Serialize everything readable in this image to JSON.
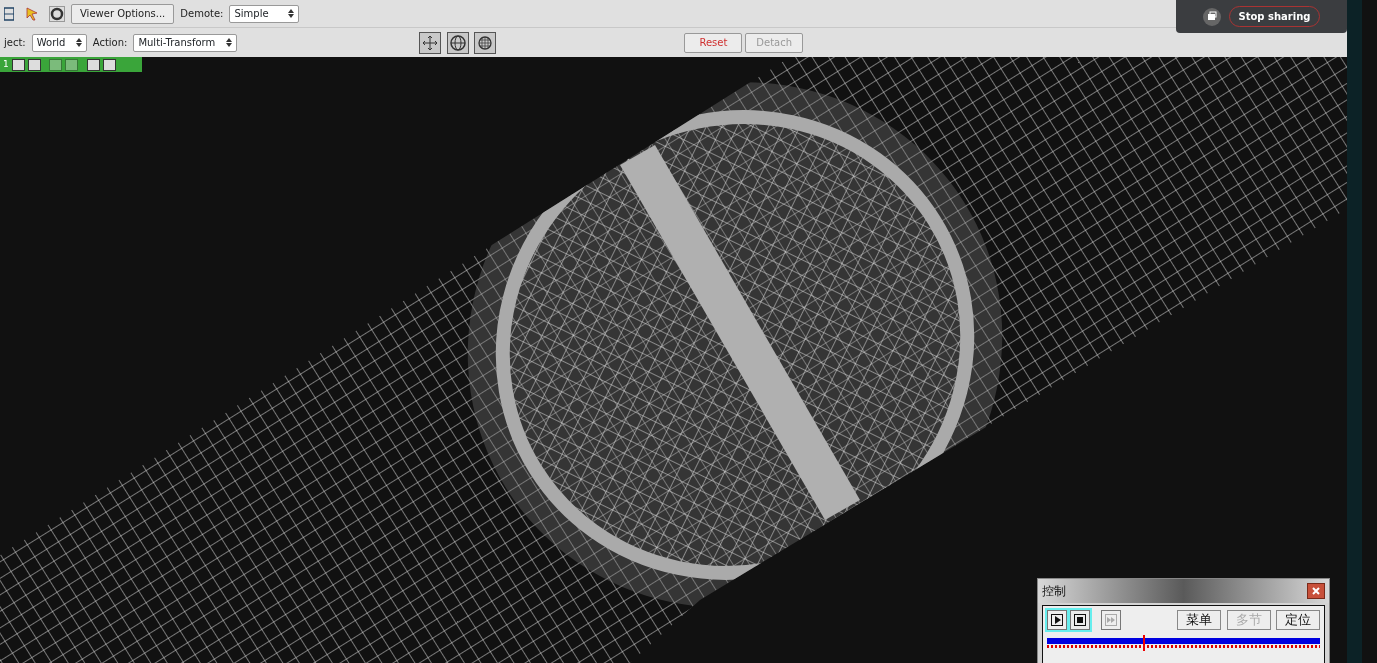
{
  "toolbar_top": {
    "viewer_options_button": "Viewer Options...",
    "demote_label": "Demote:",
    "demote_select": "Simple"
  },
  "toolbar_bottom": {
    "object_label": "ject:",
    "object_select": "World",
    "action_label": "Action:",
    "action_select": "Multi-Transform",
    "reset_button": "Reset",
    "detach_button": {
      "label": "Detach",
      "disabled": true
    }
  },
  "viewport": {
    "index": "1"
  },
  "sharing": {
    "stop_button": "Stop sharing"
  },
  "control_dialog": {
    "title": "控制",
    "transport": [
      {
        "kind": "play",
        "disabled": false
      },
      {
        "kind": "stop",
        "disabled": false
      },
      {
        "kind": "step",
        "disabled": true
      }
    ],
    "buttons": [
      {
        "label": "菜单",
        "disabled": false
      },
      {
        "label": "多节",
        "disabled": true
      },
      {
        "label": "定位",
        "disabled": false
      }
    ],
    "timeline": {
      "level": 0.35
    }
  }
}
